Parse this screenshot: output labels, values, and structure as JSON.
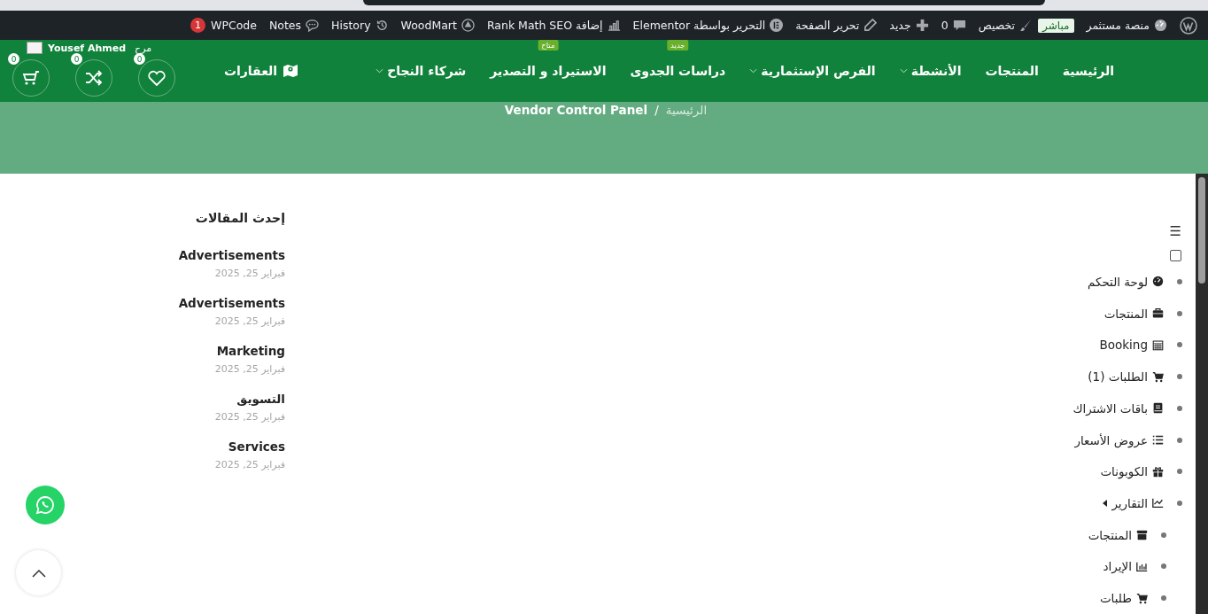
{
  "admin_bar": {
    "items": [
      {
        "kind": "site",
        "label": "منصة مستثمر"
      },
      {
        "kind": "live",
        "label": "مباشر"
      },
      {
        "kind": "customize",
        "label": "تخصيص"
      },
      {
        "kind": "comments",
        "label": "0"
      },
      {
        "kind": "new",
        "label": "جديد"
      },
      {
        "kind": "edit",
        "label": "تحرير الصفحة"
      },
      {
        "kind": "elementor",
        "label": "التحرير بواسطة Elementor"
      },
      {
        "kind": "rankmath",
        "label": "إضافة Rank Math SEO"
      },
      {
        "kind": "woodmart",
        "label": "WoodMart"
      },
      {
        "kind": "history",
        "label": "History"
      },
      {
        "kind": "notes",
        "label": "Notes"
      },
      {
        "kind": "wpcode",
        "label": "WPCode",
        "count": "1"
      }
    ]
  },
  "nav": {
    "items": [
      {
        "label": "الرئيسية",
        "dropdown": false
      },
      {
        "label": "المنتجات",
        "dropdown": false
      },
      {
        "label": "الأنشطة",
        "dropdown": true
      },
      {
        "label": "الفرص الإستثمارية",
        "dropdown": true
      },
      {
        "label": "دراسات الجدوى",
        "dropdown": false,
        "badge": "جديد"
      },
      {
        "label": "الاستيراد و التصدير",
        "dropdown": false,
        "badge": "متاح"
      },
      {
        "label": "شركاء النجاح",
        "dropdown": true
      }
    ],
    "real_estate": "العقارات",
    "user": {
      "greeting": "مرح",
      "name": "Yousef Ahmed"
    },
    "wishlist_count": "0",
    "compare_count": "0",
    "cart_count": "0"
  },
  "breadcrumb": {
    "home": "الرئيسية",
    "separator": "/",
    "current": "Vendor Control Panel"
  },
  "vendor_menu": {
    "toggle": "☰",
    "checked": false,
    "items": [
      {
        "label": "لوحة التحكم"
      },
      {
        "label": "المنتجات"
      },
      {
        "label": "Booking"
      },
      {
        "label": "الطلبات (1)"
      },
      {
        "label": "باقات الاشتراك"
      },
      {
        "label": "عروض الأسعار"
      },
      {
        "label": "الكوبونات"
      },
      {
        "label": "التقارير",
        "children": [
          {
            "label": "المنتجات"
          },
          {
            "label": "الإيراد"
          },
          {
            "label": "طلبات"
          }
        ]
      }
    ]
  },
  "recent_posts": {
    "title": "إحدث المقالات",
    "posts": [
      {
        "title": "Advertisements",
        "date": "فبراير 25, 2025"
      },
      {
        "title": "Advertisements",
        "date": "فبراير 25, 2025"
      },
      {
        "title": "Marketing",
        "date": "فبراير 25, 2025"
      },
      {
        "title": "التسويق",
        "date": "فبراير 25, 2025"
      },
      {
        "title": "Services",
        "date": "فبراير 25, 2025"
      }
    ]
  }
}
